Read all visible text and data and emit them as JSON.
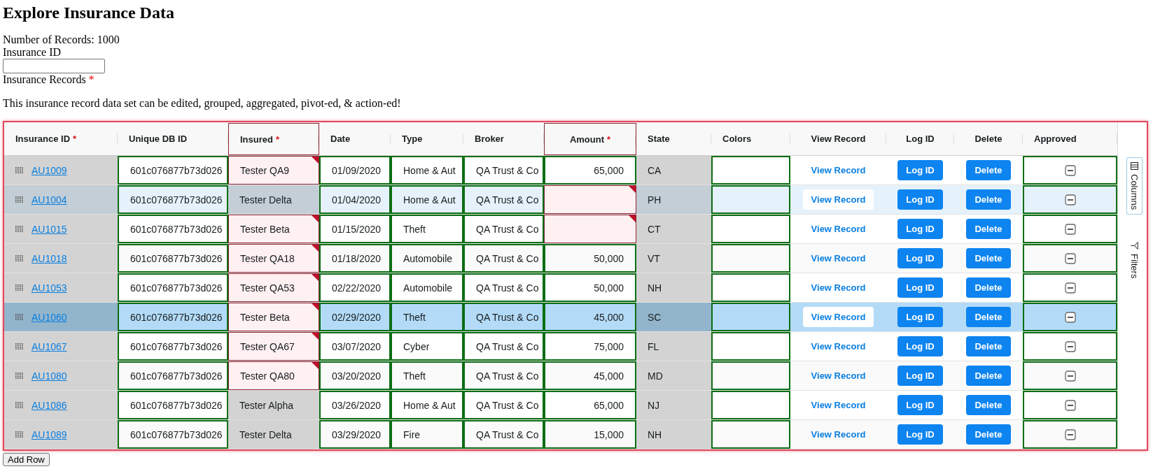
{
  "title": "Explore Insurance Data",
  "record_count": "Number of Records: 1000",
  "id_field": {
    "label": "Insurance ID"
  },
  "records_label": {
    "text": "Insurance Records",
    "required_mark": "*"
  },
  "description": "This insurance record data set can be edited, grouped, aggregated, pivot-ed, & action-ed!",
  "columns": [
    {
      "label": "Insurance ID",
      "required_mark": "*",
      "flagged": false,
      "kind": "text"
    },
    {
      "label": "Unique DB ID",
      "flagged": false,
      "kind": "text"
    },
    {
      "label": "Insured",
      "required_mark": "*",
      "flagged": true,
      "kind": "text"
    },
    {
      "label": "Date",
      "flagged": false,
      "kind": "text"
    },
    {
      "label": "Type",
      "flagged": false,
      "kind": "text"
    },
    {
      "label": "Broker",
      "flagged": false,
      "kind": "text"
    },
    {
      "label": "Amount",
      "required_mark": "*",
      "flagged": true,
      "kind": "center"
    },
    {
      "label": "State",
      "flagged": false,
      "kind": "text"
    },
    {
      "label": "Colors",
      "flagged": false,
      "kind": "text"
    },
    {
      "label": "View Record",
      "flagged": false,
      "kind": "center"
    },
    {
      "label": "Log ID",
      "flagged": false,
      "kind": "center"
    },
    {
      "label": "Delete",
      "flagged": false,
      "kind": "center"
    },
    {
      "label": "Approved",
      "flagged": false,
      "kind": "text"
    }
  ],
  "rows": [
    {
      "id": "AU1009",
      "db_id": "601c076877b73d026",
      "insured": "Tester QA9",
      "insured_flagged": true,
      "date": "01/09/2020",
      "type": "Home & Aut",
      "broker": "QA Trust & Co",
      "amount": "65,000",
      "amount_flagged": false,
      "state": "CA",
      "view": "View Record",
      "log": "Log ID",
      "delete": "Delete",
      "approved_checked": false,
      "approved_indeterminate": true,
      "selected": false,
      "hovered": false
    },
    {
      "id": "AU1004",
      "db_id": "601c076877b73d026",
      "insured": "Tester Delta",
      "insured_flagged": false,
      "date": "01/04/2020",
      "type": "Home & Aut",
      "broker": "QA Trust & Co",
      "amount_flagged": true,
      "state": "PH",
      "view": "View Record",
      "log": "Log ID",
      "delete": "Delete",
      "approved_checked": false,
      "approved_indeterminate": true,
      "selected": false,
      "hovered": true
    },
    {
      "id": "AU1015",
      "db_id": "601c076877b73d026",
      "insured": "Tester Beta",
      "insured_flagged": true,
      "date": "01/15/2020",
      "type": "Theft",
      "broker": "QA Trust & Co",
      "amount_flagged": true,
      "state": "CT",
      "view": "View Record",
      "log": "Log ID",
      "delete": "Delete",
      "approved_checked": false,
      "approved_indeterminate": true,
      "selected": false,
      "hovered": false
    },
    {
      "id": "AU1018",
      "db_id": "601c076877b73d026",
      "insured": "Tester QA18",
      "insured_flagged": true,
      "date": "01/18/2020",
      "type": "Automobile",
      "broker": "QA Trust & Co",
      "amount": "50,000",
      "amount_flagged": false,
      "state": "VT",
      "view": "View Record",
      "log": "Log ID",
      "delete": "Delete",
      "approved_checked": false,
      "approved_indeterminate": true,
      "selected": false,
      "hovered": false
    },
    {
      "id": "AU1053",
      "db_id": "601c076877b73d026",
      "insured": "Tester QA53",
      "insured_flagged": true,
      "date": "02/22/2020",
      "type": "Automobile",
      "broker": "QA Trust & Co",
      "amount": "50,000",
      "amount_flagged": false,
      "state": "NH",
      "view": "View Record",
      "log": "Log ID",
      "delete": "Delete",
      "approved_checked": false,
      "approved_indeterminate": true,
      "selected": false,
      "hovered": false
    },
    {
      "id": "AU1060",
      "db_id": "601c076877b73d026",
      "insured": "Tester Beta",
      "insured_flagged": true,
      "date": "02/29/2020",
      "type": "Theft",
      "broker": "QA Trust & Co",
      "amount": "45,000",
      "amount_flagged": false,
      "state": "SC",
      "view": "View Record",
      "log": "Log ID",
      "delete": "Delete",
      "approved_checked": false,
      "approved_indeterminate": true,
      "selected": true,
      "hovered": false
    },
    {
      "id": "AU1067",
      "db_id": "601c076877b73d026",
      "insured": "Tester QA67",
      "insured_flagged": true,
      "date": "03/07/2020",
      "type": "Cyber",
      "broker": "QA Trust & Co",
      "amount": "75,000",
      "amount_flagged": false,
      "state": "FL",
      "view": "View Record",
      "log": "Log ID",
      "delete": "Delete",
      "approved_checked": false,
      "approved_indeterminate": true,
      "selected": false,
      "hovered": false
    },
    {
      "id": "AU1080",
      "db_id": "601c076877b73d026",
      "insured": "Tester QA80",
      "insured_flagged": true,
      "date": "03/20/2020",
      "type": "Theft",
      "broker": "QA Trust & Co",
      "amount": "45,000",
      "amount_flagged": false,
      "state": "MD",
      "view": "View Record",
      "log": "Log ID",
      "delete": "Delete",
      "approved_checked": false,
      "approved_indeterminate": true,
      "selected": false,
      "hovered": false
    },
    {
      "id": "AU1086",
      "db_id": "601c076877b73d026",
      "insured": "Tester Alpha",
      "insured_flagged": false,
      "date": "03/26/2020",
      "type": "Home & Aut",
      "broker": "QA Trust & Co",
      "amount": "65,000",
      "amount_flagged": false,
      "state": "NJ",
      "view": "View Record",
      "log": "Log ID",
      "delete": "Delete",
      "approved_checked": false,
      "approved_indeterminate": true,
      "selected": false,
      "hovered": false
    },
    {
      "id": "AU1089",
      "db_id": "601c076877b73d026",
      "insured": "Tester Delta",
      "insured_flagged": false,
      "date": "03/29/2020",
      "type": "Fire",
      "broker": "QA Trust & Co",
      "amount": "15,000",
      "amount_flagged": false,
      "state": "NH",
      "view": "View Record",
      "log": "Log ID",
      "delete": "Delete",
      "approved_checked": false,
      "approved_indeterminate": true,
      "selected": false,
      "hovered": false
    }
  ],
  "side_tabs": [
    {
      "label": "Columns",
      "kind": "columns",
      "selected": true
    },
    {
      "label": "Filters",
      "kind": "filters",
      "selected": false
    }
  ],
  "add_button": "Add Row"
}
